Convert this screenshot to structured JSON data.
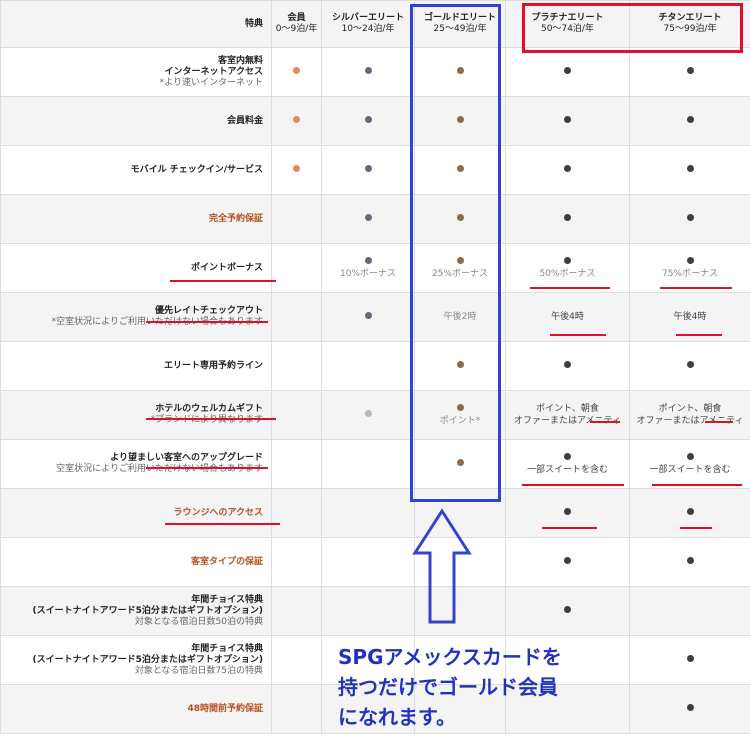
{
  "header": {
    "benefits": "特典",
    "member": "会員",
    "member_range": "0〜9泊/年",
    "silver": "シルバーエリート",
    "silver_range": "10〜24泊/年",
    "gold": "ゴールドエリート",
    "gold_range": "25〜49泊/年",
    "platinum": "プラチナエリート",
    "platinum_range": "50〜74泊/年",
    "titanium": "チタンエリート",
    "titanium_range": "75〜99泊/年"
  },
  "rows": [
    {
      "label1": "客室内無料",
      "label2": "インターネットアクセス",
      "sub": "*より速いインターネット"
    },
    {
      "label1": "会員料金"
    },
    {
      "label1": "モバイル チェックイン/サービス"
    },
    {
      "label1": "完全予約保証"
    },
    {
      "label1": "ポイントボーナス",
      "silver": "10%ボーナス",
      "gold": "25%ボーナス",
      "platinum": "50%ボーナス",
      "titanium": "75%ボーナス"
    },
    {
      "label1": "優先レイトチェックアウト",
      "sub": "*空室状況によりご利用いただけない場合もあります",
      "gold": "午後2時",
      "platinum": "午後4時",
      "titanium": "午後4時"
    },
    {
      "label1": "エリート専用予約ライン"
    },
    {
      "label1": "ホテルのウェルカムギフト",
      "sub": "*ブランドにより異なります",
      "gold": "ポイント*",
      "platinum1": "ポイント、朝食",
      "platinum2": "オファーまたはアメニティ",
      "titanium1": "ポイント、朝食",
      "titanium2": "オファーまたはアメニティ"
    },
    {
      "label1": "より望ましい客室へのアップグレード",
      "sub": "空室状況によりご利用いただけない場合もあります",
      "platinum": "一部スイートを含む",
      "titanium": "一部スイートを含む"
    },
    {
      "label1": "ラウンジへのアクセス"
    },
    {
      "label1": "客室タイプの保証"
    },
    {
      "label1": "年間チョイス特典",
      "label2": "(スイートナイトアワード5泊分またはギフトオプション)",
      "sub": "対象となる宿泊日数50泊の特典"
    },
    {
      "label1": "年間チョイス特典",
      "label2": "(スイートナイトアワード5泊分またはギフトオプション)",
      "sub": "対象となる宿泊日数75泊の特典"
    },
    {
      "label1": "48時間前予約保証"
    }
  ],
  "caption": {
    "line1": "SPGアメックスカードを",
    "line2": "持つだけでゴールド会員",
    "line3": "になれます。"
  },
  "colors": {
    "annotation_red": "#e0102a",
    "annotation_blue": "#3344cc",
    "member_dot": "#e8895a",
    "label_orange": "#b0501e"
  }
}
